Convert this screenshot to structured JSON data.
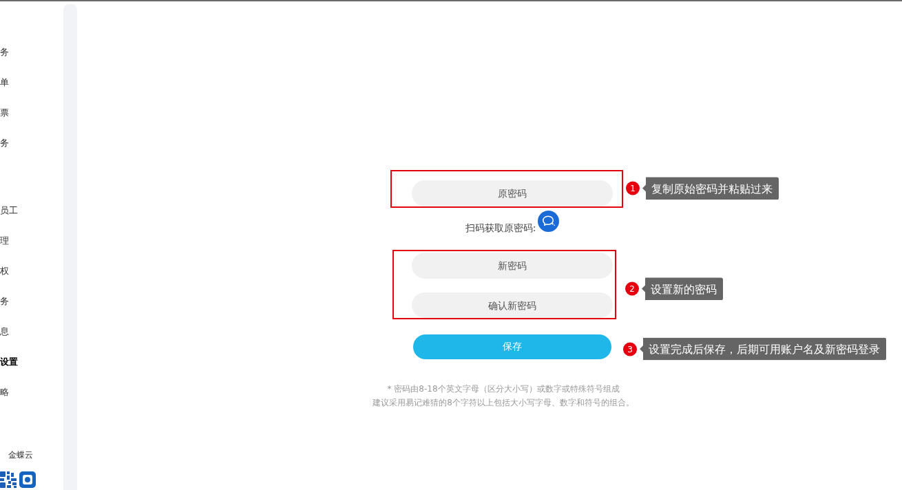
{
  "sidebar": {
    "groups": [
      {
        "items": [
          {
            "label": "务",
            "selected": false
          },
          {
            "label": "单",
            "selected": false
          },
          {
            "label": "票",
            "selected": false
          },
          {
            "label": "务",
            "selected": false
          }
        ]
      },
      {
        "items": [
          {
            "label": "员工",
            "selected": false
          },
          {
            "label": "理",
            "selected": false
          },
          {
            "label": "权",
            "selected": false
          },
          {
            "label": "务",
            "selected": false
          },
          {
            "label": "息",
            "selected": false
          },
          {
            "label": "设置",
            "selected": true
          },
          {
            "label": "略",
            "selected": false
          }
        ]
      }
    ],
    "brand": "金蝶云"
  },
  "form": {
    "old_password": {
      "placeholder": "原密码"
    },
    "scan_label": "扫码获取原密码:",
    "new_password": {
      "placeholder": "新密码"
    },
    "confirm_password": {
      "placeholder": "确认新密码"
    },
    "save_button": "保存",
    "notes": [
      "* 密码由8-18个英文字母（区分大小写）或数字或特殊符号组成",
      "建议采用易记难猜的8个字符以上包括大小写字母、数字和符号的组合。"
    ]
  },
  "annotations": [
    {
      "number": "1",
      "text": "复制原始密码并粘贴过来"
    },
    {
      "number": "2",
      "text": "设置新的密码"
    },
    {
      "number": "3",
      "text": "设置完成后保存，后期可用账户名及新密码登录"
    }
  ]
}
